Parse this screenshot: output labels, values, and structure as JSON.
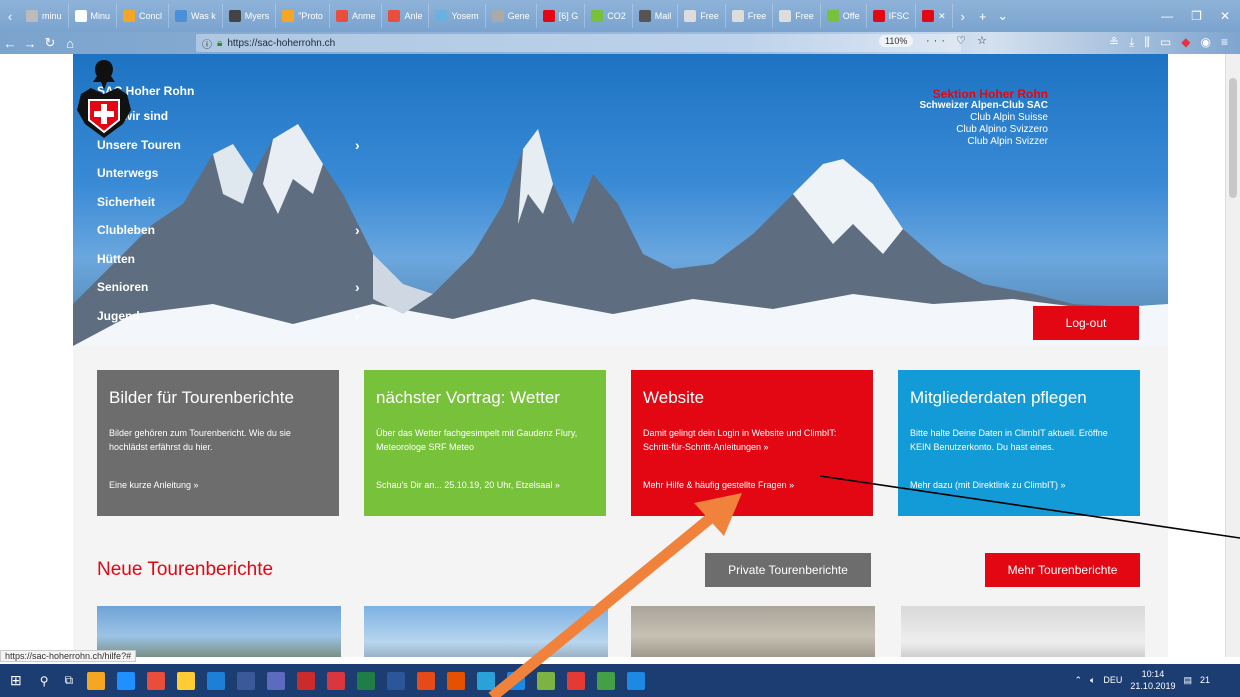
{
  "browser": {
    "tabs": [
      {
        "label": "minu",
        "color": "#bbbbbb"
      },
      {
        "label": "Minu",
        "color": "#ffffff"
      },
      {
        "label": "Concl",
        "color": "#f5a623"
      },
      {
        "label": "Was k",
        "color": "#4a90d9"
      },
      {
        "label": "Myers",
        "color": "#444444"
      },
      {
        "label": "\"Proto",
        "color": "#f5a623"
      },
      {
        "label": "Anme",
        "color": "#e94e3c"
      },
      {
        "label": "Anle",
        "color": "#e94e3c"
      },
      {
        "label": "Yosem",
        "color": "#6bb1e0"
      },
      {
        "label": "Gene",
        "color": "#aaaaaa"
      },
      {
        "label": "[6] G",
        "color": "#e30613"
      },
      {
        "label": "CO2",
        "color": "#78c13a"
      },
      {
        "label": "Mail",
        "color": "#555555"
      },
      {
        "label": "Free",
        "color": "#dddddd"
      },
      {
        "label": "Free",
        "color": "#dddddd"
      },
      {
        "label": "Free",
        "color": "#dddddd"
      },
      {
        "label": "Offe",
        "color": "#78c13a"
      },
      {
        "label": "IFSC",
        "color": "#e30613"
      },
      {
        "label": "✕",
        "color": "#e30613"
      }
    ],
    "url": "https://sac-hoherrohn.ch",
    "zoom": "110%",
    "url_actions": "··· ♡ ☆",
    "status_url": "https://sac-hoherrohn.ch/hilfe?#"
  },
  "hero": {
    "nav_title": "SAC Hoher Rohn",
    "nav_items": [
      "Wer wir sind",
      "Unsere Touren",
      "Unterwegs",
      "Sicherheit",
      "Clubleben",
      "Hütten",
      "Senioren",
      "Jugend"
    ],
    "chevron": "›",
    "brand_section": "Sektion Hoher Rohn",
    "brand_club": "Schweizer Alpen-Club SAC",
    "brand_lang1": "Club Alpin Suisse",
    "brand_lang2": "Club Alpino Svizzero",
    "brand_lang3": "Club Alpin Svizzer",
    "logout": "Log-out"
  },
  "cards": [
    {
      "title": "Bilder für Tourenberichte",
      "body": "Bilder gehören zum Tourenbericht. Wie du sie hochlädst erfährst du hier.",
      "link": "Eine kurze Anleitung »"
    },
    {
      "title": "nächster Vortrag: Wetter",
      "body": "Über das Wetter fachgesimpelt mit Gaudenz Flury, Meteorologe SRF Meteo",
      "link": "Schau's Dir an... 25.10.19, 20 Uhr, Etzelsaal »"
    },
    {
      "title": "Website",
      "body": "Damit gelingt dein Login in Website und ClimbIT: Schritt-für-Schritt-Anleitungen »",
      "link": "Mehr Hilfe & häufig gestellte Fragen »"
    },
    {
      "title": "Mitgliederdaten pflegen",
      "body": "Bitte halte Deine Daten in ClimbIT aktuell. Eröffne KEIN Benutzerkonto. Du hast eines.",
      "link": "Mehr dazu (mit Direktlink zu ClimbIT) »"
    }
  ],
  "tours": {
    "heading": "Neue Tourenberichte",
    "private_button": "Private Tourenberichte",
    "more_button": "Mehr Tourenberichte"
  },
  "taskbar": {
    "lang": "DEU",
    "time": "10:14",
    "date": "21.10.2019",
    "notifications": "21"
  },
  "colors": {
    "accent_red": "#e30613",
    "green": "#78c13a",
    "blue": "#139bd8",
    "gray": "#6d6d6d",
    "annotation_orange": "#f0823c"
  }
}
